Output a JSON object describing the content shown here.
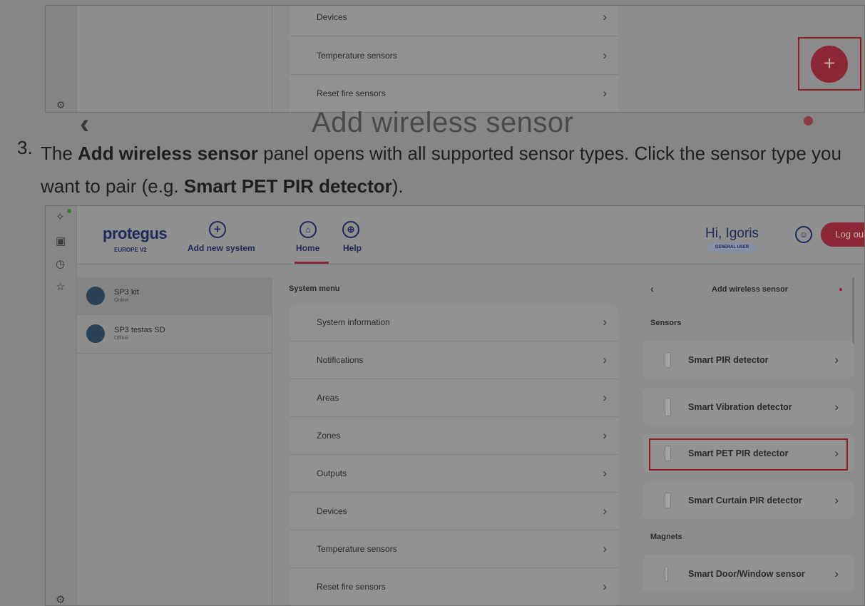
{
  "top_shot": {
    "menu": [
      {
        "label": "Devices"
      },
      {
        "label": "Temperature sensors"
      },
      {
        "label": "Reset fire sensors"
      }
    ],
    "fab_icon": "plus-icon",
    "gear_icon": "gear-icon"
  },
  "instruction": {
    "background_title": "Add wireless sensor",
    "number": "3.",
    "part1": "The ",
    "bold1": "Add wireless sensor",
    "part2": " panel opens with all supported sensor types. Click the sensor type you want to pair (e.g. ",
    "bold2": "Smart PET PIR detector",
    "part3": ")."
  },
  "app": {
    "logo": "protegus",
    "logo_sub": "EUROPE V2",
    "add_system": "Add new system",
    "nav": {
      "home": "Home",
      "help": "Help"
    },
    "greeting_hi": "Hi,",
    "greeting_name": "Igoris",
    "role": "GENERAL USER",
    "logout": "Log out",
    "systems": [
      {
        "name": "SP3 kit",
        "status": "Online"
      },
      {
        "name": "SP3 testas SD",
        "status": "Offline"
      }
    ],
    "system_menu_title": "System menu",
    "system_menu": [
      {
        "label": "System information"
      },
      {
        "label": "Notifications"
      },
      {
        "label": "Areas"
      },
      {
        "label": "Zones"
      },
      {
        "label": "Outputs"
      },
      {
        "label": "Devices"
      },
      {
        "label": "Temperature sensors"
      },
      {
        "label": "Reset fire sensors"
      }
    ],
    "panel": {
      "title": "Add wireless sensor",
      "sections": {
        "sensors": "Sensors",
        "magnets": "Magnets"
      },
      "sensors": [
        {
          "label": "Smart PIR detector"
        },
        {
          "label": "Smart Vibration detector"
        },
        {
          "label": "Smart PET PIR detector"
        },
        {
          "label": "Smart Curtain PIR detector"
        }
      ],
      "magnets": [
        {
          "label": "Smart Door/Window sensor"
        }
      ]
    }
  },
  "colors": {
    "accent": "#d6304d",
    "brand_navy": "#1e2a5a",
    "highlight_box": "#c0202a"
  }
}
